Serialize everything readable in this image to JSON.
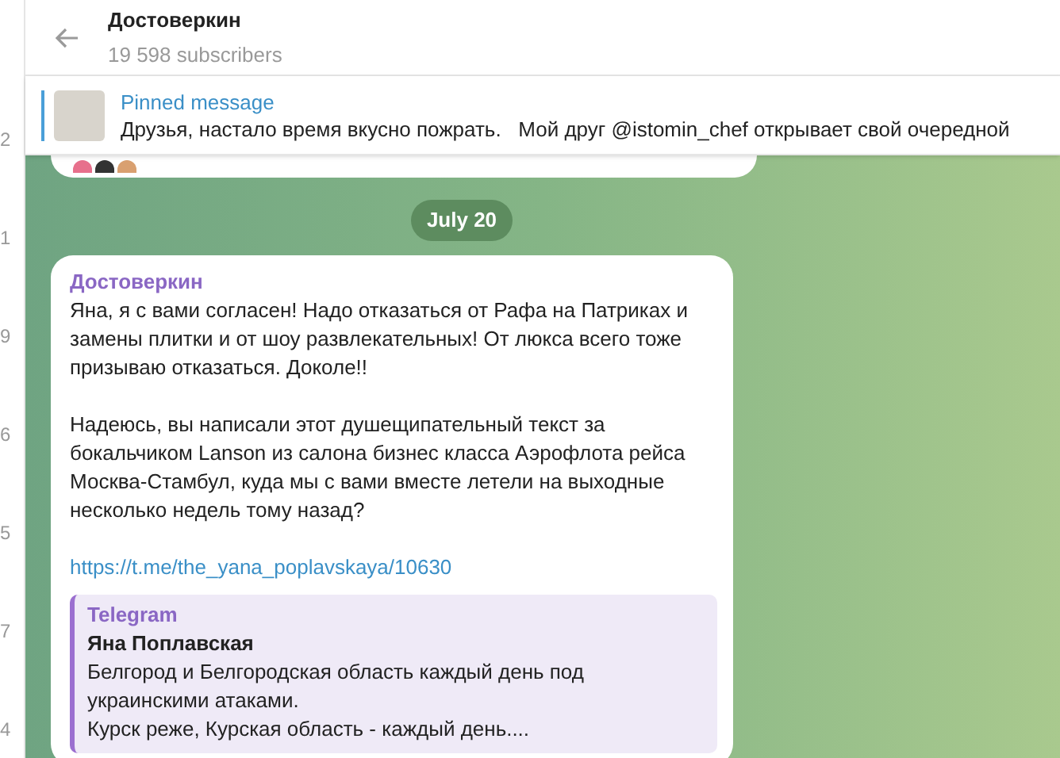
{
  "left_strip": {
    "counters": [
      "2",
      "1",
      "9",
      "6",
      "5",
      "7",
      "4"
    ]
  },
  "header": {
    "title": "Достоверкин",
    "subtitle": "19 598 subscribers"
  },
  "pinned": {
    "label": "Pinned message",
    "text": "Друзья, настало время вкусно пожрать.   Мой друг @istomin_chef открывает свой очередной"
  },
  "date_pill": "July 20",
  "message": {
    "author": "Достоверкин",
    "paragraphs": [
      "Яна, я с вами согласен! Надо отказаться от Рафа на Патриках и замены плитки и от шоу развлекательных! От люкса всего тоже призываю отказаться. Доколе!!",
      "Надеюсь, вы написали этот душещипательный текст за бокальчиком Lanson из салона бизнес класса Аэрофлота рейса Москва-Стамбул, куда мы с вами вместе летели на выходные несколько недель тому назад?"
    ],
    "link": "https://t.me/the_yana_poplavskaya/10630",
    "preview": {
      "site": "Telegram",
      "title": "Яна Поплавская",
      "lines": [
        "Белгород и Белгородская область каждый день под украинскими атаками.",
        "Курск реже, Курская область - каждый день...."
      ]
    }
  }
}
